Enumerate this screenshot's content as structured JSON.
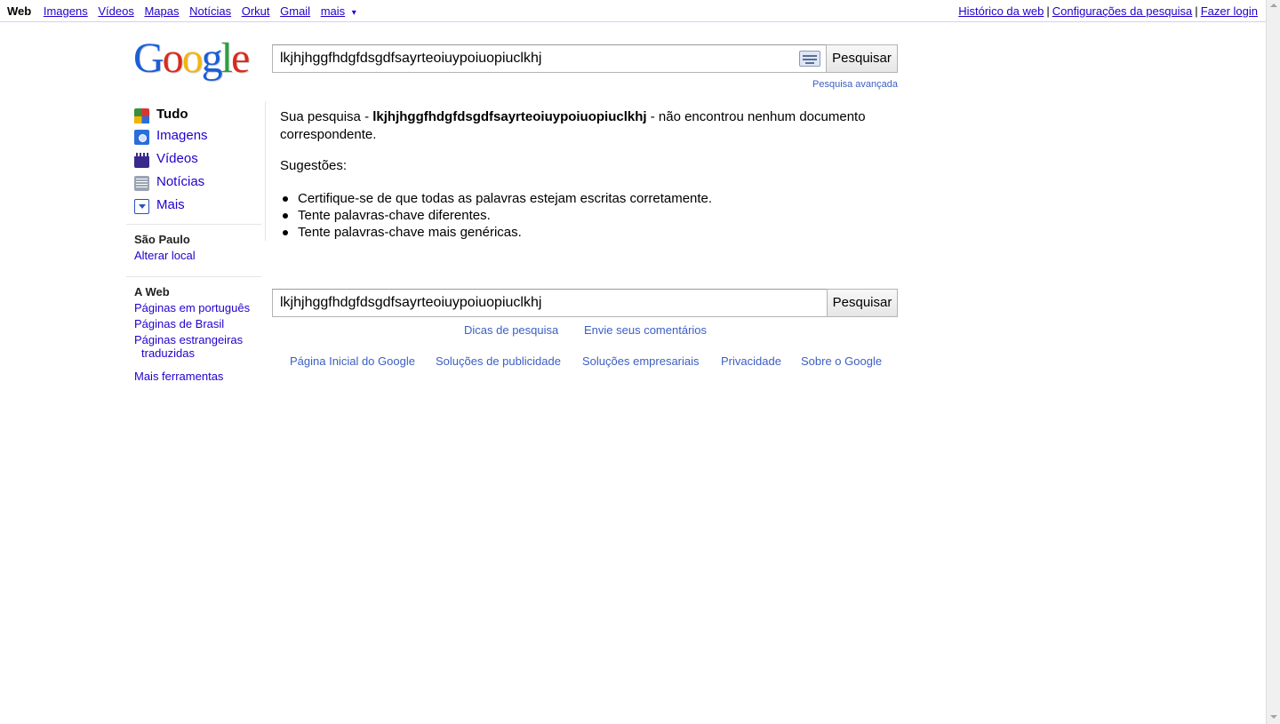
{
  "topbar": {
    "nav": [
      {
        "label": "Web",
        "current": true
      },
      {
        "label": "Imagens"
      },
      {
        "label": "Vídeos"
      },
      {
        "label": "Mapas"
      },
      {
        "label": "Notícias"
      },
      {
        "label": "Orkut"
      },
      {
        "label": "Gmail"
      },
      {
        "label": "mais"
      }
    ],
    "more_caret": "▾",
    "right_links": [
      "Histórico da web",
      "Configurações da pesquisa",
      "Fazer login"
    ],
    "separator": "|"
  },
  "logo": {
    "letters": [
      "G",
      "o",
      "o",
      "g",
      "l",
      "e"
    ]
  },
  "search": {
    "query": "lkjhjhggfhdgfdsgdfsayrteoiuypoiuopiuclkhj",
    "button_label": "Pesquisar",
    "advanced_link": "Pesquisa avançada"
  },
  "sidebar": {
    "items": [
      {
        "label": "Tudo",
        "icon": "tudo-icon",
        "current": true
      },
      {
        "label": "Imagens",
        "icon": "camera-icon"
      },
      {
        "label": "Vídeos",
        "icon": "film-icon"
      },
      {
        "label": "Notícias",
        "icon": "news-icon"
      },
      {
        "label": "Mais",
        "icon": "dropdown-icon"
      }
    ],
    "location": {
      "title": "São Paulo",
      "change_link": "Alterar local"
    },
    "web": {
      "title": "A Web",
      "links": [
        "Páginas em português",
        "Páginas de Brasil",
        "Páginas estrangeiras",
        "traduzidas"
      ],
      "tools_link": "Mais ferramentas"
    }
  },
  "results": {
    "msg_prefix": "Sua pesquisa - ",
    "msg_query": "lkjhjhggfhdgfdsgdfsayrteoiuypoiuopiuclkhj",
    "msg_suffix": " - não encontrou nenhum documento correspondente.",
    "suggestions_title": "Sugestões:",
    "suggestions": [
      "Certifique-se de que todas as palavras estejam escritas corretamente.",
      "Tente palavras-chave diferentes.",
      "Tente palavras-chave mais genéricas."
    ]
  },
  "bottom_search": {
    "query": "lkjhjhggfhdgfdsgdfsayrteoiuypoiuopiuclkhj",
    "button_label": "Pesquisar"
  },
  "footer": {
    "row1": [
      "Dicas de pesquisa",
      "Envie seus comentários"
    ],
    "row2": [
      "Página Inicial do Google",
      "Soluções de publicidade",
      "Soluções empresariais",
      "Privacidade",
      "Sobre o Google"
    ]
  },
  "colors": {
    "link": "#2200cc",
    "footer_link": "#3b5fc4",
    "topbar_border": "#c9d7f1"
  }
}
